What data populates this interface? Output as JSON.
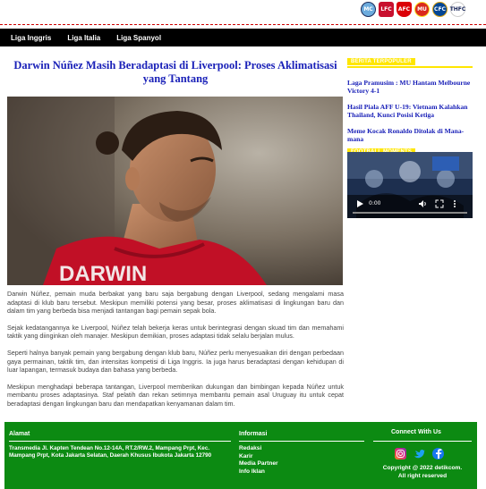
{
  "clubs": [
    {
      "name": "manchester-city",
      "abbr": "MC",
      "color": "#6cabdd"
    },
    {
      "name": "liverpool",
      "abbr": "LFC",
      "color": "#c8102e"
    },
    {
      "name": "arsenal",
      "abbr": "AFC",
      "color": "#db0007"
    },
    {
      "name": "manchester-united",
      "abbr": "MU",
      "color": "#da291c"
    },
    {
      "name": "chelsea",
      "abbr": "CFC",
      "color": "#034694"
    },
    {
      "name": "tottenham",
      "abbr": "THFC",
      "color": "#132257"
    }
  ],
  "nav": {
    "items": [
      "Liga Inggris",
      "Liga Italia",
      "Liga Spanyol"
    ]
  },
  "article": {
    "title": "Darwin Núñez Masih Beradaptasi di Liverpool: Proses Aklimatisasi yang Tantang",
    "hero_text": "DARWIN",
    "paragraphs": [
      "Darwin Núñez, pemain muda berbakat yang baru saja bergabung dengan Liverpool, sedang mengalami masa adaptasi di klub baru tersebut. Meskipun memiliki potensi yang besar, proses aklimatisasi di lingkungan baru dan dalam tim yang berbeda bisa menjadi tantangan bagi pemain sepak bola.",
      "Sejak kedatangannya ke Liverpool, Núñez telah bekerja keras untuk berintegrasi dengan skuad tim dan memahami taktik yang diinginkan oleh manajer. Meskipun demikian, proses adaptasi tidak selalu berjalan mulus.",
      "Seperti halnya banyak pemain yang bergabung dengan klub baru, Núñez perlu menyesuaikan diri dengan perbedaan gaya permainan, taktik tim, dan intensitas kompetisi di Liga Inggris. Ia juga harus beradaptasi dengan kehidupan di luar lapangan, termasuk budaya dan bahasa yang berbeda.",
      "Meskipun menghadapi beberapa tantangan, Liverpool memberikan dukungan dan bimbingan kepada Núñez untuk membantu proses adaptasinya. Staf pelatih dan rekan setimnya membantu pemain asal Uruguay itu untuk cepat beradaptasi dengan lingkungan baru dan mendapatkan kenyamanan dalam tim."
    ]
  },
  "sidebar": {
    "popular_heading": "BERITA TERPOPULER",
    "links": [
      "Laga Pramusim : MU Hantam Melbourne Victory 4-1",
      "Hasil Piala AFF U-19: Vietnam Kalahkan Thailand, Kunci Posisi Ketiga",
      "Meme Kocak Ronaldo Ditolak di Mana-mana"
    ],
    "video_heading": "FOOTBALL MOMENTS",
    "video_time": "0:00"
  },
  "footer": {
    "address_heading": "Alamat",
    "address": "Transmedia Jl. Kapten Tendean No.12-14A, RT.2/RW.2, Mampang Prpt, Kec. Mampang Prpt, Kota Jakarta Selatan, Daerah Khusus Ibukota Jakarta 12790",
    "info_heading": "Informasi",
    "info_links": [
      "Redaksi",
      "Karir",
      "Media Partner",
      "Info Iklan"
    ],
    "connect_heading": "Connect With Us",
    "copyright_line1": "Copyright @ 2022 detikcom.",
    "copyright_line2": "All right reserved"
  }
}
